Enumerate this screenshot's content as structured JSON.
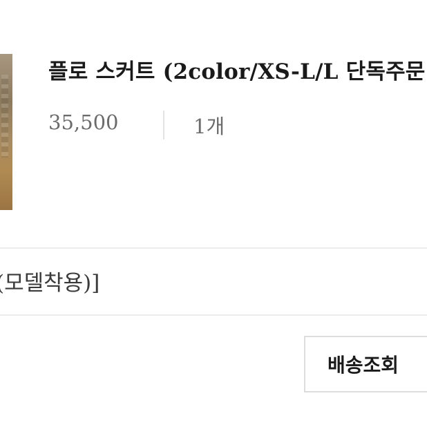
{
  "product": {
    "title": "플로 스커트 (2color/XS-L/L 단독주문",
    "price": "35,500",
    "quantity": "1개",
    "option_text": "(모델착용)]"
  },
  "actions": {
    "track_shipping_label": "배송조회"
  }
}
